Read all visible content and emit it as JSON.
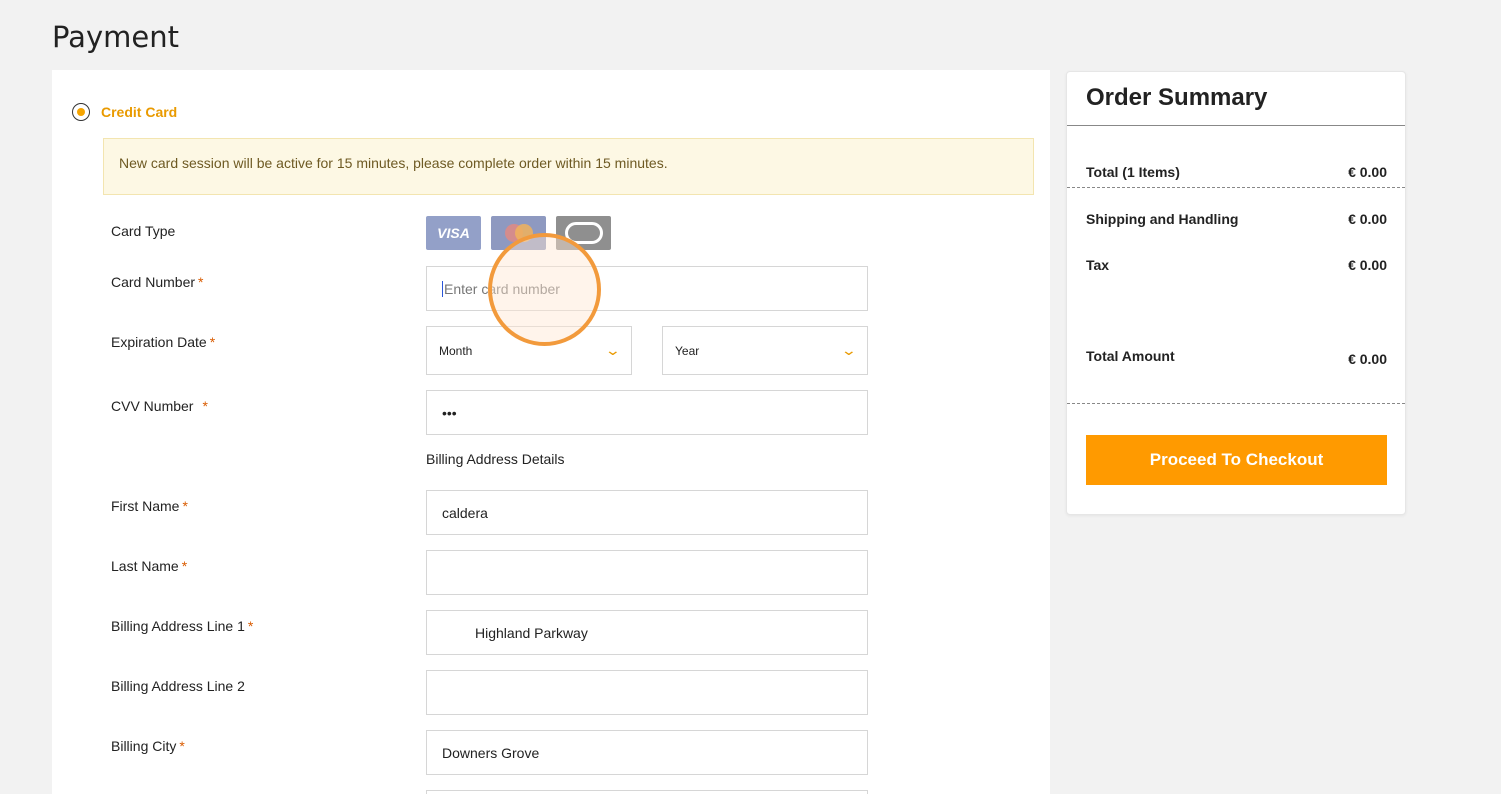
{
  "page": {
    "title": "Payment"
  },
  "payment_method": {
    "label": "Credit Card",
    "selected": true
  },
  "notice": "New card session will be active for 15 minutes, please complete order within 15 minutes.",
  "fields": {
    "card_type": {
      "label": "Card Type",
      "cards": [
        "VISA",
        "MasterCard",
        "CB"
      ]
    },
    "card_number": {
      "label": "Card Number",
      "placeholder": "Enter card number",
      "value": ""
    },
    "expiration": {
      "label": "Expiration Date",
      "month_placeholder": "Month",
      "year_placeholder": "Year"
    },
    "cvv": {
      "label": "CVV Number",
      "value": "•••"
    },
    "billing_heading": "Billing Address Details",
    "first_name": {
      "label": "First Name",
      "value": "caldera"
    },
    "last_name": {
      "label": "Last Name",
      "value": ""
    },
    "address1": {
      "label": "Billing Address Line 1",
      "value": "Highland Parkway"
    },
    "address2": {
      "label": "Billing Address Line 2",
      "value": ""
    },
    "city": {
      "label": "Billing City",
      "value": "Downers Grove"
    },
    "required_mark": "*"
  },
  "summary": {
    "title": "Order Summary",
    "rows": [
      {
        "label": "Total (1 Items)",
        "value": "€ 0.00"
      },
      {
        "label": "Shipping and Handling",
        "value": "€ 0.00"
      },
      {
        "label": "Tax",
        "value": "€ 0.00"
      },
      {
        "label": "Total Amount",
        "value": "€ 0.00"
      }
    ],
    "checkout_label": "Proceed To Checkout"
  },
  "colors": {
    "accent": "#ff9a00",
    "notice_bg": "#fdf8e4",
    "required": "#d95b00"
  },
  "icons": [
    "radio-selected-icon",
    "visa-icon",
    "mastercard-icon",
    "cb-card-icon",
    "chevron-down-icon"
  ]
}
